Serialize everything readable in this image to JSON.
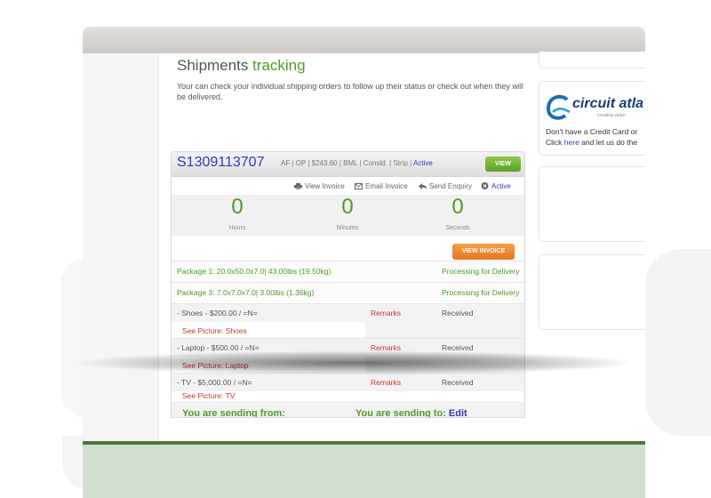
{
  "page": {
    "title_plain": "Shipments",
    "title_accent": "tracking",
    "intro": "Your can check your individual shipping orders to follow up their status or check out when they will be delivered."
  },
  "order": {
    "id": "S1309113707",
    "meta": "AF | OP | $243.60 | BML | Consld. | Strip |",
    "status": "Active",
    "view_label": "VIEW"
  },
  "actions": {
    "view_invoice": "View Invoice",
    "email_invoice": "Email Invoice",
    "send_enquiry": "Send Enquiry",
    "status": "Active"
  },
  "countdown": {
    "hours": "0",
    "hours_label": "Hours",
    "minutes": "0",
    "minutes_label": "Minutes",
    "seconds": "0",
    "seconds_label": "Seconds"
  },
  "view_invoice_button": "VIEW INVOICE",
  "packages": [
    {
      "desc": "Package 1: 20.0x50.0x7.0| 43.00lbs (19.50kg)",
      "status": "Processing for Delivery"
    },
    {
      "desc": "Package 3: 7.0x7.0x7.0| 3.00lbs (1.36kg)",
      "status": "Processing for Delivery"
    }
  ],
  "items": [
    {
      "desc": "- Shoes - $200.00 / =N=",
      "remarks": "Remarks",
      "status": "Received",
      "picture": "See Picture: Shoes"
    },
    {
      "desc": "- Laptop - $500.00 / =N=",
      "remarks": "Remarks",
      "status": "Received",
      "picture": "See Picture: Laptop"
    },
    {
      "desc": "- TV - $5,000.00 / =N=",
      "remarks": "Remarks",
      "status": "Received",
      "picture": "See Picture: TV"
    }
  ],
  "sending": {
    "from_label": "You are sending from:",
    "to_label": "You are sending to:",
    "edit_label": "Edit"
  },
  "sidebar": {
    "logo_text": "circuit atla",
    "logo_sub": "creating value",
    "promo_line1": "Don't have a Credit Card or",
    "promo_click": "Click",
    "promo_link": "here",
    "promo_rest": "and let us do the"
  },
  "colors": {
    "accent_green": "#4d9a2a",
    "link_blue": "#2b3db0",
    "alert_red": "#c0392b",
    "button_orange": "#e5741b"
  }
}
